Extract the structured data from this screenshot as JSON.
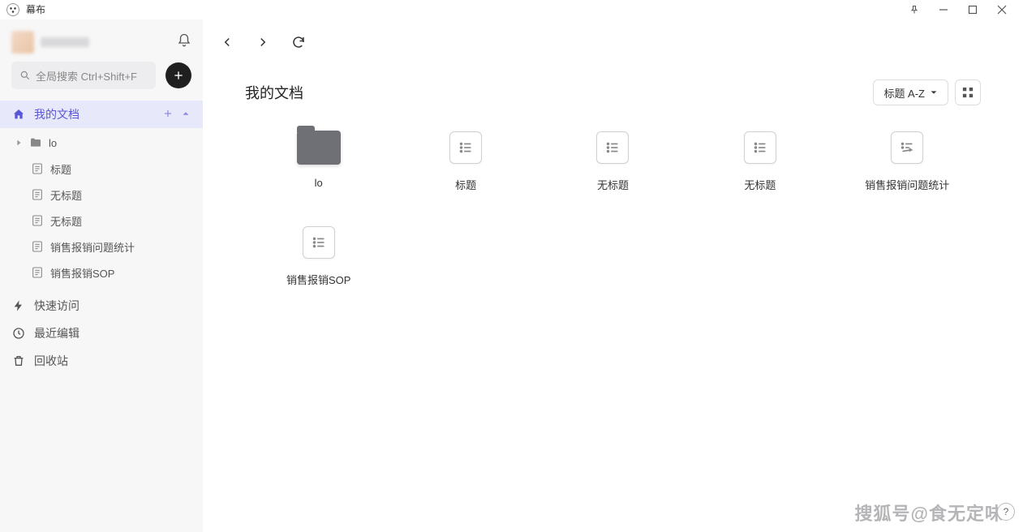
{
  "app": {
    "title": "幕布"
  },
  "sidebar": {
    "search_placeholder": "全局搜索 Ctrl+Shift+F",
    "my_docs_label": "我的文档",
    "quick_access_label": "快速访问",
    "recent_label": "最近编辑",
    "trash_label": "回收站",
    "tree": [
      {
        "label": "lo",
        "type": "folder"
      },
      {
        "label": "标题",
        "type": "doc"
      },
      {
        "label": "无标题",
        "type": "doc"
      },
      {
        "label": "无标题",
        "type": "doc"
      },
      {
        "label": "销售报销问题统计",
        "type": "doc"
      },
      {
        "label": "销售报销SOP",
        "type": "doc"
      }
    ]
  },
  "main": {
    "page_title": "我的文档",
    "sort_label": "标题 A-Z",
    "items": [
      {
        "name": "lo",
        "kind": "folder"
      },
      {
        "name": "标题",
        "kind": "doc"
      },
      {
        "name": "无标题",
        "kind": "doc"
      },
      {
        "name": "无标题",
        "kind": "doc"
      },
      {
        "name": "销售报销问题统计",
        "kind": "doc-share"
      },
      {
        "name": "销售报销SOP",
        "kind": "doc"
      }
    ]
  },
  "watermark": "搜狐号@食无定味",
  "help": "?"
}
